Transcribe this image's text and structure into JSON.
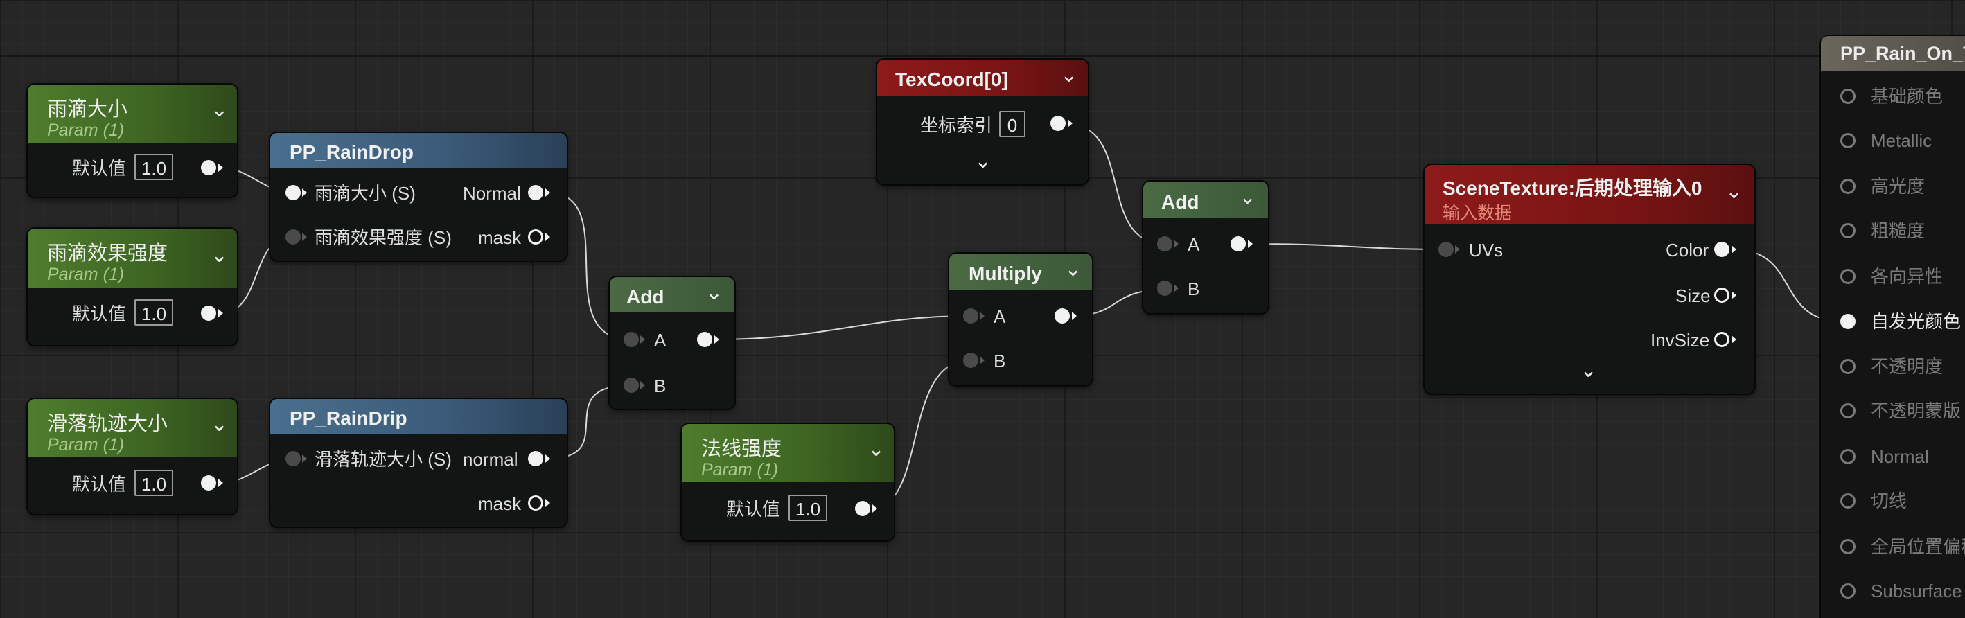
{
  "nodes": {
    "raindrop_size_param": {
      "title": "雨滴大小",
      "subtitle": "Param (1)",
      "default_label": "默认值",
      "value": "1.0"
    },
    "raindrop_strength_param": {
      "title": "雨滴效果强度",
      "subtitle": "Param (1)",
      "default_label": "默认值",
      "value": "1.0"
    },
    "trail_size_param": {
      "title": "滑落轨迹大小",
      "subtitle": "Param (1)",
      "default_label": "默认值",
      "value": "1.0"
    },
    "normal_strength_param": {
      "title": "法线强度",
      "subtitle": "Param (1)",
      "default_label": "默认值",
      "value": "1.0"
    },
    "pp_raindrop": {
      "title": "PP_RainDrop",
      "in1": "雨滴大小 (S)",
      "in2": "雨滴效果强度 (S)",
      "out1": "Normal",
      "out2": "mask"
    },
    "pp_raindrip": {
      "title": "PP_RainDrip",
      "in1": "滑落轨迹大小 (S)",
      "out1": "normal",
      "out2": "mask"
    },
    "add1": {
      "title": "Add",
      "in_a": "A",
      "in_b": "B"
    },
    "multiply": {
      "title": "Multiply",
      "in_a": "A",
      "in_b": "B"
    },
    "texcoord": {
      "title": "TexCoord[0]",
      "index_label": "坐标索引",
      "index_value": "0"
    },
    "add2": {
      "title": "Add",
      "in_a": "A",
      "in_b": "B"
    },
    "scenetexture": {
      "title": "SceneTexture:后期处理输入0",
      "subtitle": "输入数据",
      "in_uvs": "UVs",
      "out_color": "Color",
      "out_size": "Size",
      "out_invsize": "InvSize"
    }
  },
  "material_output": {
    "title": "PP_Rain_On_T",
    "inputs": [
      "基础颜色",
      "Metallic",
      "高光度",
      "粗糙度",
      "各向异性",
      "自发光颜色",
      "不透明度",
      "不透明蒙版",
      "Normal",
      "切线",
      "全局位置偏移",
      "Subsurface"
    ],
    "active_input": "自发光颜色"
  },
  "icons": {
    "expand": "chevron-down-icon"
  },
  "colors": {
    "param_header": "#4e7d2c",
    "function_header": "#4a6f8e",
    "texture_header": "#8e1a1a",
    "math_header": "#4a6a44",
    "background": "#262626"
  }
}
